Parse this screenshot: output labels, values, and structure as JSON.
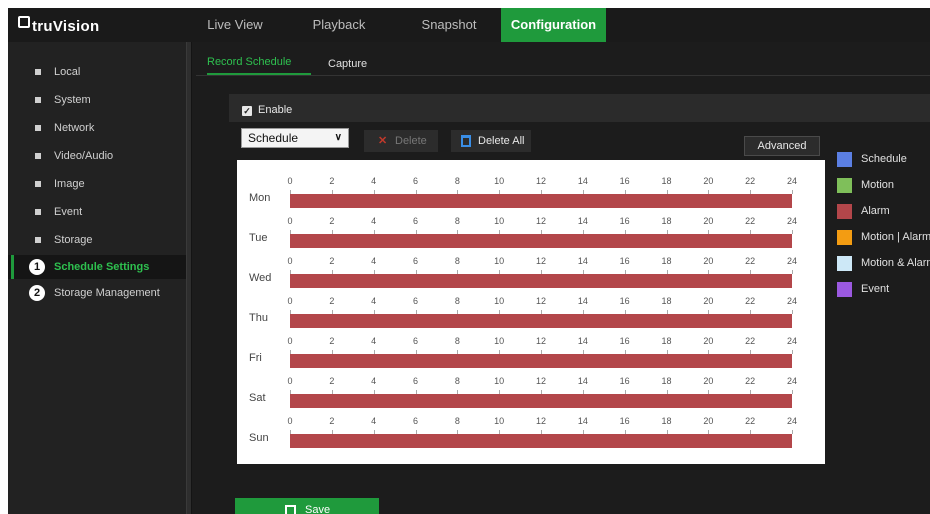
{
  "app": {
    "logo_text": "truVision"
  },
  "nav": {
    "tabs": [
      {
        "label": "Live View"
      },
      {
        "label": "Playback"
      },
      {
        "label": "Snapshot"
      },
      {
        "label": "Configuration"
      }
    ],
    "active": "Configuration"
  },
  "sidebar": {
    "items": [
      {
        "label": "Local"
      },
      {
        "label": "System"
      },
      {
        "label": "Network"
      },
      {
        "label": "Video/Audio"
      },
      {
        "label": "Image"
      },
      {
        "label": "Event"
      },
      {
        "label": "Storage"
      },
      {
        "label": "Schedule Settings",
        "marker": "1"
      },
      {
        "label": "Storage Management",
        "marker": "2"
      }
    ],
    "active": "Schedule Settings"
  },
  "subtabs": {
    "record_schedule": "Record Schedule",
    "capture": "Capture"
  },
  "enable": {
    "label": "Enable",
    "checked": true
  },
  "toolbar": {
    "type_select": "Schedule",
    "delete_label": "Delete",
    "delete_all_label": "Delete All",
    "advanced_label": "Advanced"
  },
  "schedule": {
    "hours": [
      "0",
      "2",
      "4",
      "6",
      "8",
      "10",
      "12",
      "14",
      "16",
      "18",
      "20",
      "22",
      "24"
    ],
    "days": [
      {
        "day": "Mon",
        "type": "Alarm",
        "start": 0,
        "end": 24
      },
      {
        "day": "Tue",
        "type": "Alarm",
        "start": 0,
        "end": 24
      },
      {
        "day": "Wed",
        "type": "Alarm",
        "start": 0,
        "end": 24
      },
      {
        "day": "Thu",
        "type": "Alarm",
        "start": 0,
        "end": 24
      },
      {
        "day": "Fri",
        "type": "Alarm",
        "start": 0,
        "end": 24
      },
      {
        "day": "Sat",
        "type": "Alarm",
        "start": 0,
        "end": 24
      },
      {
        "day": "Sun",
        "type": "Alarm",
        "start": 0,
        "end": 24
      }
    ]
  },
  "legend": [
    {
      "label": "Schedule",
      "color": "#5b7fe3"
    },
    {
      "label": "Motion",
      "color": "#7fbf5a"
    },
    {
      "label": "Alarm",
      "color": "#b3464a"
    },
    {
      "label": "Motion | Alarm",
      "color": "#f39c12"
    },
    {
      "label": "Motion & Alarm",
      "color": "#cde8f7"
    },
    {
      "label": "Event",
      "color": "#9b59e0"
    }
  ],
  "save_label": "Save",
  "colors": {
    "accent": "#1f9a3c",
    "alarm": "#b3464a"
  }
}
